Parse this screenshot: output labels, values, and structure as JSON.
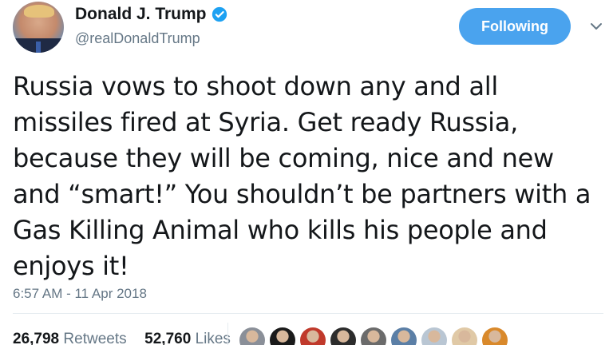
{
  "user": {
    "display_name": "Donald J. Trump",
    "handle": "@realDonaldTrump",
    "verified": true
  },
  "follow_button": {
    "label": "Following",
    "color": "#4aa3ee"
  },
  "tweet": {
    "lines": [
      "Russia vows to shoot down any and all",
      "missiles fired at Syria. Get ready Russia,",
      "because they will be coming, nice and new",
      "and “smart!” You shouldn’t be partners with a",
      "Gas Killing Animal who kills his people and",
      "enjoys it!"
    ],
    "timestamp": "6:57 AM - 11 Apr 2018"
  },
  "stats": {
    "retweets_count": "26,798",
    "retweets_label": "Retweets",
    "likes_count": "52,760",
    "likes_label": "Likes"
  },
  "likers": [
    {
      "icon": "liker-avatar",
      "color": "#8a8f98"
    },
    {
      "icon": "liker-avatar",
      "color": "#1a1a1a"
    },
    {
      "icon": "liker-avatar",
      "color": "#c0392b"
    },
    {
      "icon": "liker-avatar",
      "color": "#2c2c2c"
    },
    {
      "icon": "liker-avatar",
      "color": "#6b6b6b"
    },
    {
      "icon": "liker-avatar",
      "color": "#5b7fa6"
    },
    {
      "icon": "liker-avatar",
      "color": "#b9c6d3"
    },
    {
      "icon": "liker-avatar",
      "color": "#e0c9a6"
    },
    {
      "icon": "liker-avatar",
      "color": "#d9892b"
    }
  ],
  "colors": {
    "text": "#14171a",
    "secondary": "#657786",
    "accent": "#1da1f2"
  }
}
